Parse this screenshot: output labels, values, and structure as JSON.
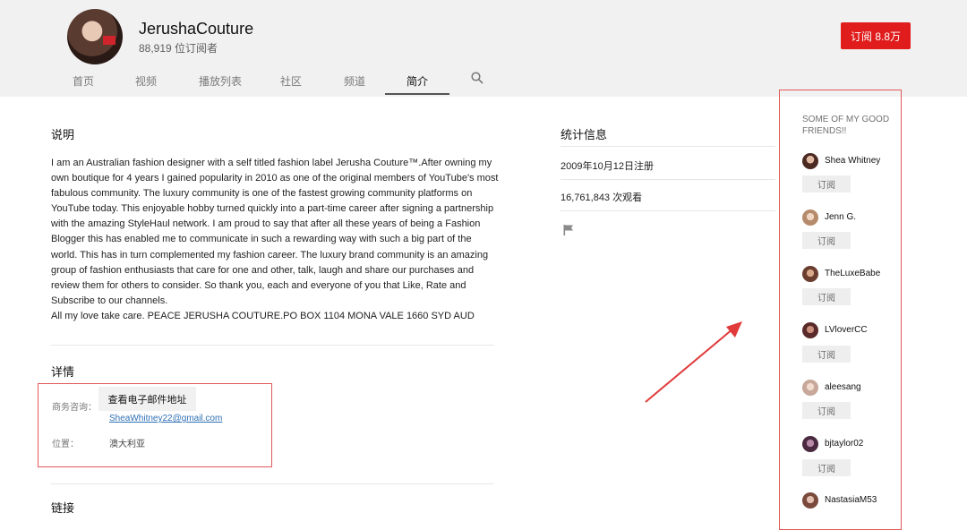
{
  "channel": {
    "name": "JerushaCouture",
    "subscribers": "88,919 位订阅者",
    "subscribe_label": "订阅 8.8万"
  },
  "tabs": [
    "首页",
    "视频",
    "播放列表",
    "社区",
    "频道",
    "简介"
  ],
  "about": {
    "description_heading": "说明",
    "description": "I am an Australian fashion designer with a self titled fashion label Jerusha Couture™.After owning my own boutique for 4 years I gained popularity in 2010 as one of the original members of YouTube's most fabulous community. The luxury community is one of the fastest growing community platforms on YouTube today. This enjoyable hobby turned quickly into a part-time career after signing a partnership with the amazing StyleHaul network. I am proud to say that after all these years of being a Fashion Blogger this has enabled me to communicate in such a rewarding way with such a big part of the world. This has in turn complemented my fashion career. The luxury brand community is an amazing group of fashion enthusiasts that care for one and other, talk, laugh and share our purchases and review them for others to consider. So thank you, each and everyone of you that Like, Rate and Subscribe to our channels.\nAll my love take care. PEACE JERUSHA COUTURE.PO BOX 1104 MONA VALE 1660 SYD AUD",
    "details_heading": "详情",
    "business_label": "商务咨询：",
    "email_button": "查看电子邮件地址",
    "email": "SheaWhitney22@gmail.com",
    "location_label": "位置：",
    "location": "澳大利亚",
    "links_heading": "链接"
  },
  "stats": {
    "heading": "统计信息",
    "joined": "2009年10月12日注册",
    "views": "16,761,843 次观看"
  },
  "friends": {
    "title": "SOME OF MY GOOD FRIENDS!!",
    "subscribe_label": "订阅",
    "items": [
      {
        "name": "Shea Whitney"
      },
      {
        "name": "Jenn G."
      },
      {
        "name": "TheLuxeBabe"
      },
      {
        "name": "LVloverCC"
      },
      {
        "name": "aleesang"
      },
      {
        "name": "bjtaylor02"
      },
      {
        "name": "NastasiaM53"
      }
    ]
  },
  "colors": {
    "subscribe": "#e01c1c",
    "annotation": "#e05858",
    "link": "#2f6fb5"
  },
  "icons": [
    "search-icon",
    "flag-icon"
  ]
}
